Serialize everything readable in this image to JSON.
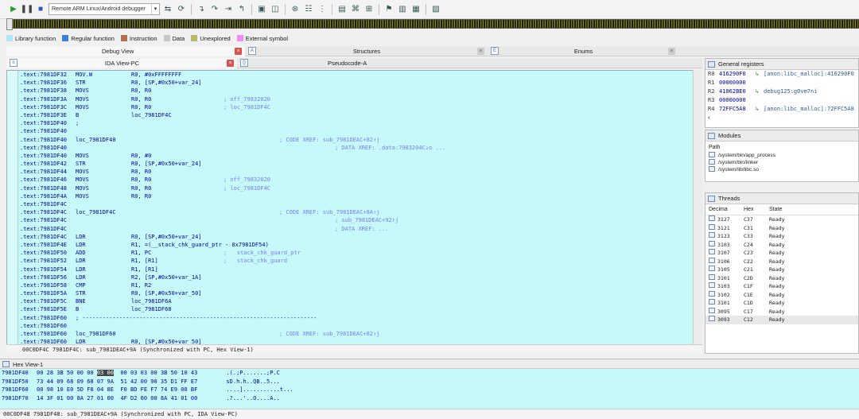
{
  "toolbar": {
    "debugger_name": "Remote ARM Linux/Android debugger",
    "icons": [
      "play-icon",
      "pause-icon",
      "stop-icon"
    ]
  },
  "legend": [
    {
      "label": "Library function",
      "color": "#aee8f8"
    },
    {
      "label": "Regular function",
      "color": "#3d7fd8"
    },
    {
      "label": "Instruction",
      "color": "#b07050"
    },
    {
      "label": "Data",
      "color": "#c8c8c8"
    },
    {
      "label": "Unexplored",
      "color": "#b8b870"
    },
    {
      "label": "External symbol",
      "color": "#f08cf0"
    }
  ],
  "top_tabs": {
    "debug_view": "Debug View",
    "structures": "Structures",
    "enums": "Enums"
  },
  "sub_tabs": {
    "ida_view": "IDA View-PC",
    "pseudocode": "Pseudocode-A"
  },
  "code_lines": [
    {
      "addr": ".text:7981DF32",
      "mn": "MOV.W",
      "op": "R0, #0xFFFFFFFF",
      "cm": ""
    },
    {
      "addr": ".text:7981DF36",
      "mn": "STR",
      "op": "R0, [SP,#0x50+var_24]",
      "cm": ""
    },
    {
      "addr": ".text:7981DF38",
      "mn": "MOVS",
      "op": "R0, R0",
      "cm": ""
    },
    {
      "addr": ".text:7981DF3A",
      "mn": "MOVS",
      "op": "R0, R0",
      "cm": "; off_79832020"
    },
    {
      "addr": ".text:7981DF3C",
      "mn": "MOVS",
      "op": "R0, R0",
      "cm": "; loc_7981DF4C"
    },
    {
      "addr": ".text:7981DF3E",
      "mn": "B",
      "op": "loc_7981DF4C",
      "cm": ""
    },
    {
      "addr": ".text:7981DF40",
      "mn": ";",
      "op": "",
      "cm": ""
    },
    {
      "addr": ".text:7981DF40",
      "mn": "",
      "op": "",
      "cm": ""
    },
    {
      "addr": ".text:7981DF40",
      "mn": "loc_7981DF40",
      "op": "",
      "cm": "; CODE XREF: sub_7981DEAC+82↑j"
    },
    {
      "addr": ".text:7981DF40",
      "mn": "",
      "op": "",
      "cm": "; DATA XREF: .data:7983204C↓o ..."
    },
    {
      "addr": ".text:7981DF40",
      "mn": "MOVS",
      "op": "R0, #0",
      "cm": ""
    },
    {
      "addr": ".text:7981DF42",
      "mn": "STR",
      "op": "R0, [SP,#0x50+var_24]",
      "cm": ""
    },
    {
      "addr": ".text:7981DF44",
      "mn": "MOVS",
      "op": "R0, R0",
      "cm": ""
    },
    {
      "addr": ".text:7981DF46",
      "mn": "MOVS",
      "op": "R0, R0",
      "cm": "; off_79832020"
    },
    {
      "addr": ".text:7981DF48",
      "mn": "MOVS",
      "op": "R0, R0",
      "cm": "; loc_7981DF4C"
    },
    {
      "addr": ".text:7981DF4A",
      "mn": "MOVS",
      "op": "R0, R0",
      "cm": ""
    },
    {
      "addr": ".text:7981DF4C",
      "mn": "",
      "op": "",
      "cm": ""
    },
    {
      "addr": ".text:7981DF4C",
      "mn": "loc_7981DF4C",
      "op": "",
      "cm": "; CODE XREF: sub_7981DEAC+8A↑j"
    },
    {
      "addr": ".text:7981DF4C",
      "mn": "",
      "op": "",
      "cm": "; sub_7981DEAC+92↑j"
    },
    {
      "addr": ".text:7981DF4C",
      "mn": "",
      "op": "",
      "cm": "; DATA XREF: ..."
    },
    {
      "addr": ".text:7981DF4C",
      "mn": "LDR",
      "op": "R0, [SP,#0x50+var_24]",
      "cm": ""
    },
    {
      "addr": ".text:7981DF4E",
      "mn": "LDR",
      "op": "R1, =(__stack_chk_guard_ptr - 0x7981DF54)",
      "cm": ""
    },
    {
      "addr": ".text:7981DF50",
      "mn": "ADD",
      "op": "R1, PC",
      "cm": ";   stack_chk_guard_ptr"
    },
    {
      "addr": ".text:7981DF52",
      "mn": "LDR",
      "op": "R1, [R1]",
      "cm": ";   stack_chk_guard"
    },
    {
      "addr": ".text:7981DF54",
      "mn": "LDR",
      "op": "R1, [R1]",
      "cm": ""
    },
    {
      "addr": ".text:7981DF56",
      "mn": "LDR",
      "op": "R2, [SP,#0x50+var_1A]",
      "cm": ""
    },
    {
      "addr": ".text:7981DF58",
      "mn": "CMP",
      "op": "R1, R2",
      "cm": ""
    },
    {
      "addr": ".text:7981DF5A",
      "mn": "STR",
      "op": "R0, [SP,#0x50+var_50]",
      "cm": ""
    },
    {
      "addr": ".text:7981DF5C",
      "mn": "BNE",
      "op": "loc_7981DF6A",
      "cm": ""
    },
    {
      "addr": ".text:7981DF5E",
      "mn": "B",
      "op": "loc_7981DF60",
      "cm": ""
    },
    {
      "addr": ".text:7981DF60",
      "mn": "; ----------------------------------------------------------------------",
      "op": "",
      "cm": ""
    },
    {
      "addr": ".text:7981DF60",
      "mn": "",
      "op": "",
      "cm": ""
    },
    {
      "addr": ".text:7981DF60",
      "mn": "loc_7981DF60",
      "op": "",
      "cm": "; CODE XREF: sub_7981DEAC+82↑j"
    },
    {
      "addr": ".text:7981DF60",
      "mn": "LDR",
      "op": "R0, [SP,#0x50+var_50]",
      "cm": ""
    }
  ],
  "ida_status": "00C0DF4C 7981DF4C: sub_7981DEAC+9A (Synchronized with PC, Hex View-1)",
  "registers": {
    "title": "General registers",
    "rows": [
      {
        "name": "R0",
        "val": "416290F0",
        "desc": "[anon:libc_malloc]:416290F0"
      },
      {
        "name": "R1",
        "val": "00000000",
        "desc": ""
      },
      {
        "name": "R2",
        "val": "41062BE0",
        "desc": "debug125:gOvm7ni"
      },
      {
        "name": "R3",
        "val": "00000000",
        "desc": ""
      },
      {
        "name": "R4",
        "val": "72FFC5A8",
        "desc": "[anon:libc_malloc]:72FFC5A8"
      }
    ]
  },
  "modules": {
    "title": "Modules",
    "column": "Path",
    "rows": [
      "/system/bin/app_process",
      "/system/bin/linker",
      "/system/lib/libc.so"
    ]
  },
  "threads": {
    "title": "Threads",
    "columns": [
      "Decima",
      "Hex",
      "State"
    ],
    "rows": [
      {
        "dec": "3127",
        "hex": "C37",
        "state": "Ready"
      },
      {
        "dec": "3121",
        "hex": "C31",
        "state": "Ready"
      },
      {
        "dec": "3123",
        "hex": "C33",
        "state": "Ready"
      },
      {
        "dec": "3103",
        "hex": "C24",
        "state": "Ready"
      },
      {
        "dec": "3107",
        "hex": "C23",
        "state": "Ready"
      },
      {
        "dec": "3106",
        "hex": "C22",
        "state": "Ready"
      },
      {
        "dec": "3105",
        "hex": "C21",
        "state": "Ready"
      },
      {
        "dec": "3101",
        "hex": "C2D",
        "state": "Ready"
      },
      {
        "dec": "3103",
        "hex": "C1F",
        "state": "Ready"
      },
      {
        "dec": "3102",
        "hex": "C1E",
        "state": "Ready"
      },
      {
        "dec": "3101",
        "hex": "C1D",
        "state": "Ready"
      },
      {
        "dec": "3095",
        "hex": "C17",
        "state": "Ready"
      },
      {
        "dec": "3093",
        "hex": "C12",
        "state": "Ready"
      }
    ]
  },
  "hex": {
    "title": "Hex View-1",
    "rows": [
      {
        "addr": "7981DF40",
        "pre": "00 28 3B 50 00 00 ",
        "sel": "03 00",
        "post": "  00 03 03 00 3B 50 10 43",
        "ascii": "  .(.;P.......;P.C"
      },
      {
        "addr": "7981DF50",
        "pre": "73 44 09 68 09 68 07 9A  51 42 00 90 35 D1 FF E7",
        "sel": "",
        "post": "",
        "ascii": "  sD.h.h..QB..5..."
      },
      {
        "addr": "7981DF60",
        "pre": "00 98 10 E0 5D F8 04 8E  F0 BD FE F7 74 E9 00 BF",
        "sel": "",
        "post": "",
        "ascii": "  ....]...........t..."
      },
      {
        "addr": "7981DF70",
        "pre": "14 3F 01 00 8A 27 01 00  4F D2 00 00 8A 41 01 00",
        "sel": "",
        "post": "",
        "ascii": "  .?...'..O....A.."
      }
    ]
  },
  "bottom_status": "00C0DF48 7981DF48: sub_7981DEAC+9A (Synchronized with PC, IDA View-PC)"
}
